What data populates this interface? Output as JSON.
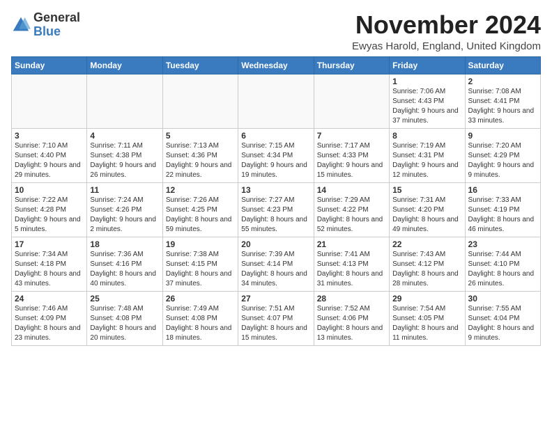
{
  "header": {
    "logo_general": "General",
    "logo_blue": "Blue",
    "month_title": "November 2024",
    "subtitle": "Ewyas Harold, England, United Kingdom"
  },
  "days_of_week": [
    "Sunday",
    "Monday",
    "Tuesday",
    "Wednesday",
    "Thursday",
    "Friday",
    "Saturday"
  ],
  "weeks": [
    [
      {
        "day": "",
        "info": ""
      },
      {
        "day": "",
        "info": ""
      },
      {
        "day": "",
        "info": ""
      },
      {
        "day": "",
        "info": ""
      },
      {
        "day": "",
        "info": ""
      },
      {
        "day": "1",
        "info": "Sunrise: 7:06 AM\nSunset: 4:43 PM\nDaylight: 9 hours and 37 minutes."
      },
      {
        "day": "2",
        "info": "Sunrise: 7:08 AM\nSunset: 4:41 PM\nDaylight: 9 hours and 33 minutes."
      }
    ],
    [
      {
        "day": "3",
        "info": "Sunrise: 7:10 AM\nSunset: 4:40 PM\nDaylight: 9 hours and 29 minutes."
      },
      {
        "day": "4",
        "info": "Sunrise: 7:11 AM\nSunset: 4:38 PM\nDaylight: 9 hours and 26 minutes."
      },
      {
        "day": "5",
        "info": "Sunrise: 7:13 AM\nSunset: 4:36 PM\nDaylight: 9 hours and 22 minutes."
      },
      {
        "day": "6",
        "info": "Sunrise: 7:15 AM\nSunset: 4:34 PM\nDaylight: 9 hours and 19 minutes."
      },
      {
        "day": "7",
        "info": "Sunrise: 7:17 AM\nSunset: 4:33 PM\nDaylight: 9 hours and 15 minutes."
      },
      {
        "day": "8",
        "info": "Sunrise: 7:19 AM\nSunset: 4:31 PM\nDaylight: 9 hours and 12 minutes."
      },
      {
        "day": "9",
        "info": "Sunrise: 7:20 AM\nSunset: 4:29 PM\nDaylight: 9 hours and 9 minutes."
      }
    ],
    [
      {
        "day": "10",
        "info": "Sunrise: 7:22 AM\nSunset: 4:28 PM\nDaylight: 9 hours and 5 minutes."
      },
      {
        "day": "11",
        "info": "Sunrise: 7:24 AM\nSunset: 4:26 PM\nDaylight: 9 hours and 2 minutes."
      },
      {
        "day": "12",
        "info": "Sunrise: 7:26 AM\nSunset: 4:25 PM\nDaylight: 8 hours and 59 minutes."
      },
      {
        "day": "13",
        "info": "Sunrise: 7:27 AM\nSunset: 4:23 PM\nDaylight: 8 hours and 55 minutes."
      },
      {
        "day": "14",
        "info": "Sunrise: 7:29 AM\nSunset: 4:22 PM\nDaylight: 8 hours and 52 minutes."
      },
      {
        "day": "15",
        "info": "Sunrise: 7:31 AM\nSunset: 4:20 PM\nDaylight: 8 hours and 49 minutes."
      },
      {
        "day": "16",
        "info": "Sunrise: 7:33 AM\nSunset: 4:19 PM\nDaylight: 8 hours and 46 minutes."
      }
    ],
    [
      {
        "day": "17",
        "info": "Sunrise: 7:34 AM\nSunset: 4:18 PM\nDaylight: 8 hours and 43 minutes."
      },
      {
        "day": "18",
        "info": "Sunrise: 7:36 AM\nSunset: 4:16 PM\nDaylight: 8 hours and 40 minutes."
      },
      {
        "day": "19",
        "info": "Sunrise: 7:38 AM\nSunset: 4:15 PM\nDaylight: 8 hours and 37 minutes."
      },
      {
        "day": "20",
        "info": "Sunrise: 7:39 AM\nSunset: 4:14 PM\nDaylight: 8 hours and 34 minutes."
      },
      {
        "day": "21",
        "info": "Sunrise: 7:41 AM\nSunset: 4:13 PM\nDaylight: 8 hours and 31 minutes."
      },
      {
        "day": "22",
        "info": "Sunrise: 7:43 AM\nSunset: 4:12 PM\nDaylight: 8 hours and 28 minutes."
      },
      {
        "day": "23",
        "info": "Sunrise: 7:44 AM\nSunset: 4:10 PM\nDaylight: 8 hours and 26 minutes."
      }
    ],
    [
      {
        "day": "24",
        "info": "Sunrise: 7:46 AM\nSunset: 4:09 PM\nDaylight: 8 hours and 23 minutes."
      },
      {
        "day": "25",
        "info": "Sunrise: 7:48 AM\nSunset: 4:08 PM\nDaylight: 8 hours and 20 minutes."
      },
      {
        "day": "26",
        "info": "Sunrise: 7:49 AM\nSunset: 4:08 PM\nDaylight: 8 hours and 18 minutes."
      },
      {
        "day": "27",
        "info": "Sunrise: 7:51 AM\nSunset: 4:07 PM\nDaylight: 8 hours and 15 minutes."
      },
      {
        "day": "28",
        "info": "Sunrise: 7:52 AM\nSunset: 4:06 PM\nDaylight: 8 hours and 13 minutes."
      },
      {
        "day": "29",
        "info": "Sunrise: 7:54 AM\nSunset: 4:05 PM\nDaylight: 8 hours and 11 minutes."
      },
      {
        "day": "30",
        "info": "Sunrise: 7:55 AM\nSunset: 4:04 PM\nDaylight: 8 hours and 9 minutes."
      }
    ]
  ]
}
